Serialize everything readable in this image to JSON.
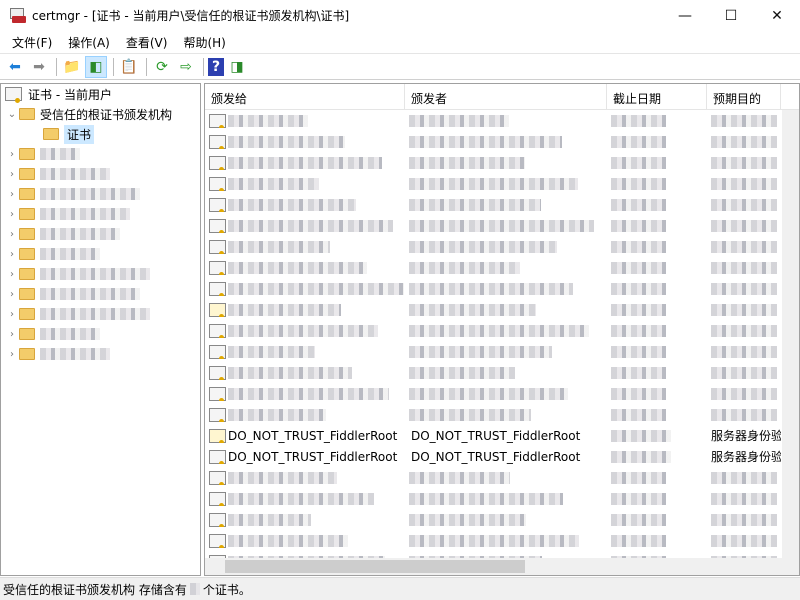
{
  "window": {
    "title": "certmgr - [证书 - 当前用户\\受信任的根证书颁发机构\\证书]",
    "minimize": "—",
    "maximize": "☐",
    "close": "✕"
  },
  "menu": [
    "文件(F)",
    "操作(A)",
    "查看(V)",
    "帮助(H)"
  ],
  "toolbar": [
    "back-icon",
    "forward-icon",
    "up-folder-icon",
    "show-hide-tree-icon",
    "properties-icon",
    "refresh-icon",
    "export-list-icon",
    "help-icon",
    "action-pane-icon"
  ],
  "tree": {
    "root": "证书 - 当前用户",
    "expanded": "受信任的根证书颁发机构",
    "selected": "证书"
  },
  "columns": [
    "颁发给",
    "颁发者",
    "截止日期",
    "预期目的"
  ],
  "visible_rows": [
    {
      "issued_to": "DO_NOT_TRUST_FiddlerRoot",
      "issued_by": "DO_NOT_TRUST_FiddlerRoot",
      "purpose": "服务器身份验"
    },
    {
      "issued_to": "DO_NOT_TRUST_FiddlerRoot",
      "issued_by": "DO_NOT_TRUST_FiddlerRoot",
      "purpose": "服务器身份验"
    }
  ],
  "status": {
    "prefix": "受信任的根证书颁发机构 存储含有",
    "suffix": "个证书。"
  }
}
